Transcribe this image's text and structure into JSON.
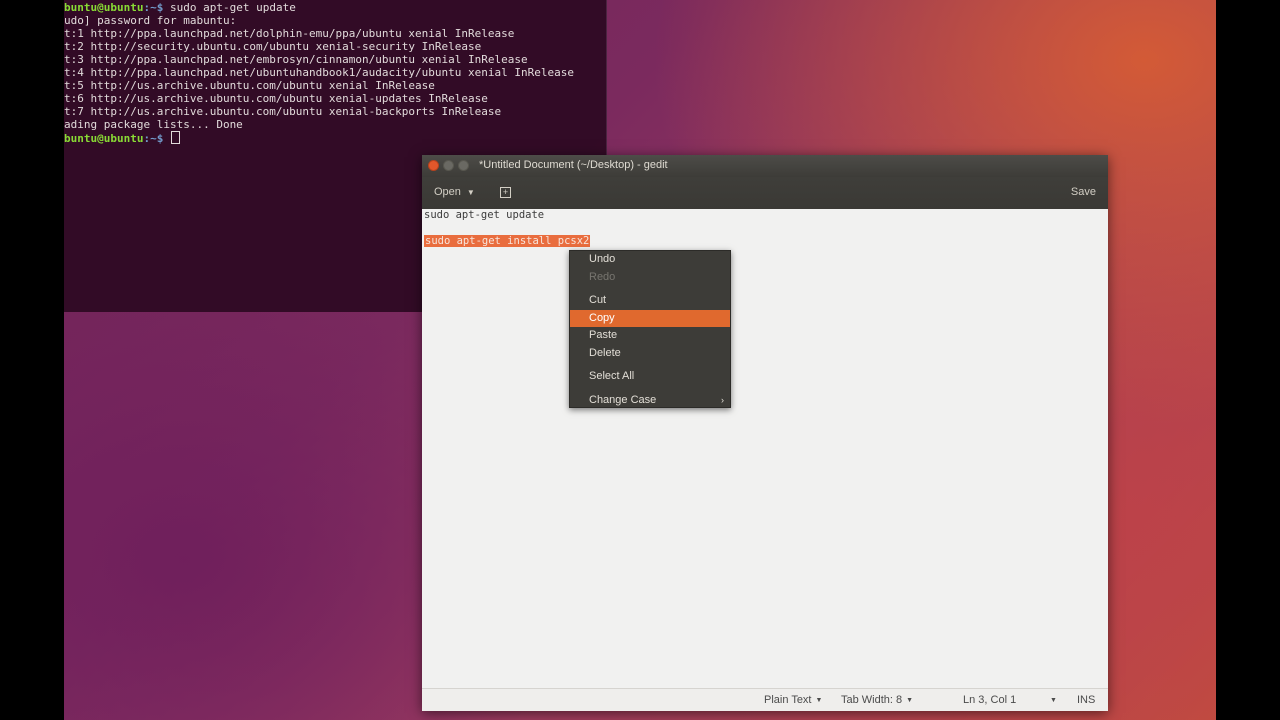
{
  "terminal": {
    "lines": [
      {
        "user": "buntu@ubuntu",
        "path": ":~$",
        "cmd": " sudo apt-get update"
      },
      {
        "text": "udo] password for mabuntu:"
      },
      {
        "text": "t:1 http://ppa.launchpad.net/dolphin-emu/ppa/ubuntu xenial InRelease"
      },
      {
        "text": "t:2 http://security.ubuntu.com/ubuntu xenial-security InRelease"
      },
      {
        "text": "t:3 http://ppa.launchpad.net/embrosyn/cinnamon/ubuntu xenial InRelease"
      },
      {
        "text": "t:4 http://ppa.launchpad.net/ubuntuhandbook1/audacity/ubuntu xenial InRelease"
      },
      {
        "text": "t:5 http://us.archive.ubuntu.com/ubuntu xenial InRelease"
      },
      {
        "text": "t:6 http://us.archive.ubuntu.com/ubuntu xenial-updates InRelease"
      },
      {
        "text": "t:7 http://us.archive.ubuntu.com/ubuntu xenial-backports InRelease"
      },
      {
        "text": "ading package lists... Done"
      },
      {
        "user": "buntu@ubuntu",
        "path": ":~$",
        "cmd": " "
      }
    ]
  },
  "gedit": {
    "title": "*Untitled Document (~/Desktop) - gedit",
    "toolbar": {
      "open_label": "Open",
      "save_label": "Save"
    },
    "editor": {
      "line1": "sudo apt-get update",
      "line3": "sudo apt-get install pcsx2"
    },
    "statusbar": {
      "language": "Plain Text",
      "tab_width": "Tab Width: 8",
      "position": "Ln 3, Col 1",
      "mode": "INS"
    }
  },
  "context_menu": {
    "items": [
      {
        "label": "Undo",
        "enabled": true
      },
      {
        "label": "Redo",
        "enabled": false
      },
      {
        "label": "Cut",
        "enabled": true
      },
      {
        "label": "Copy",
        "enabled": true,
        "highlighted": true
      },
      {
        "label": "Paste",
        "enabled": true
      },
      {
        "label": "Delete",
        "enabled": true
      },
      {
        "label": "Select All",
        "enabled": true
      },
      {
        "label": "Change Case",
        "enabled": true,
        "submenu": true
      }
    ]
  },
  "colors": {
    "terminal_bg": "#300a24",
    "prompt_user": "#8ae234",
    "selection": "#e96d3e",
    "menu_highlight": "#e0692e"
  }
}
